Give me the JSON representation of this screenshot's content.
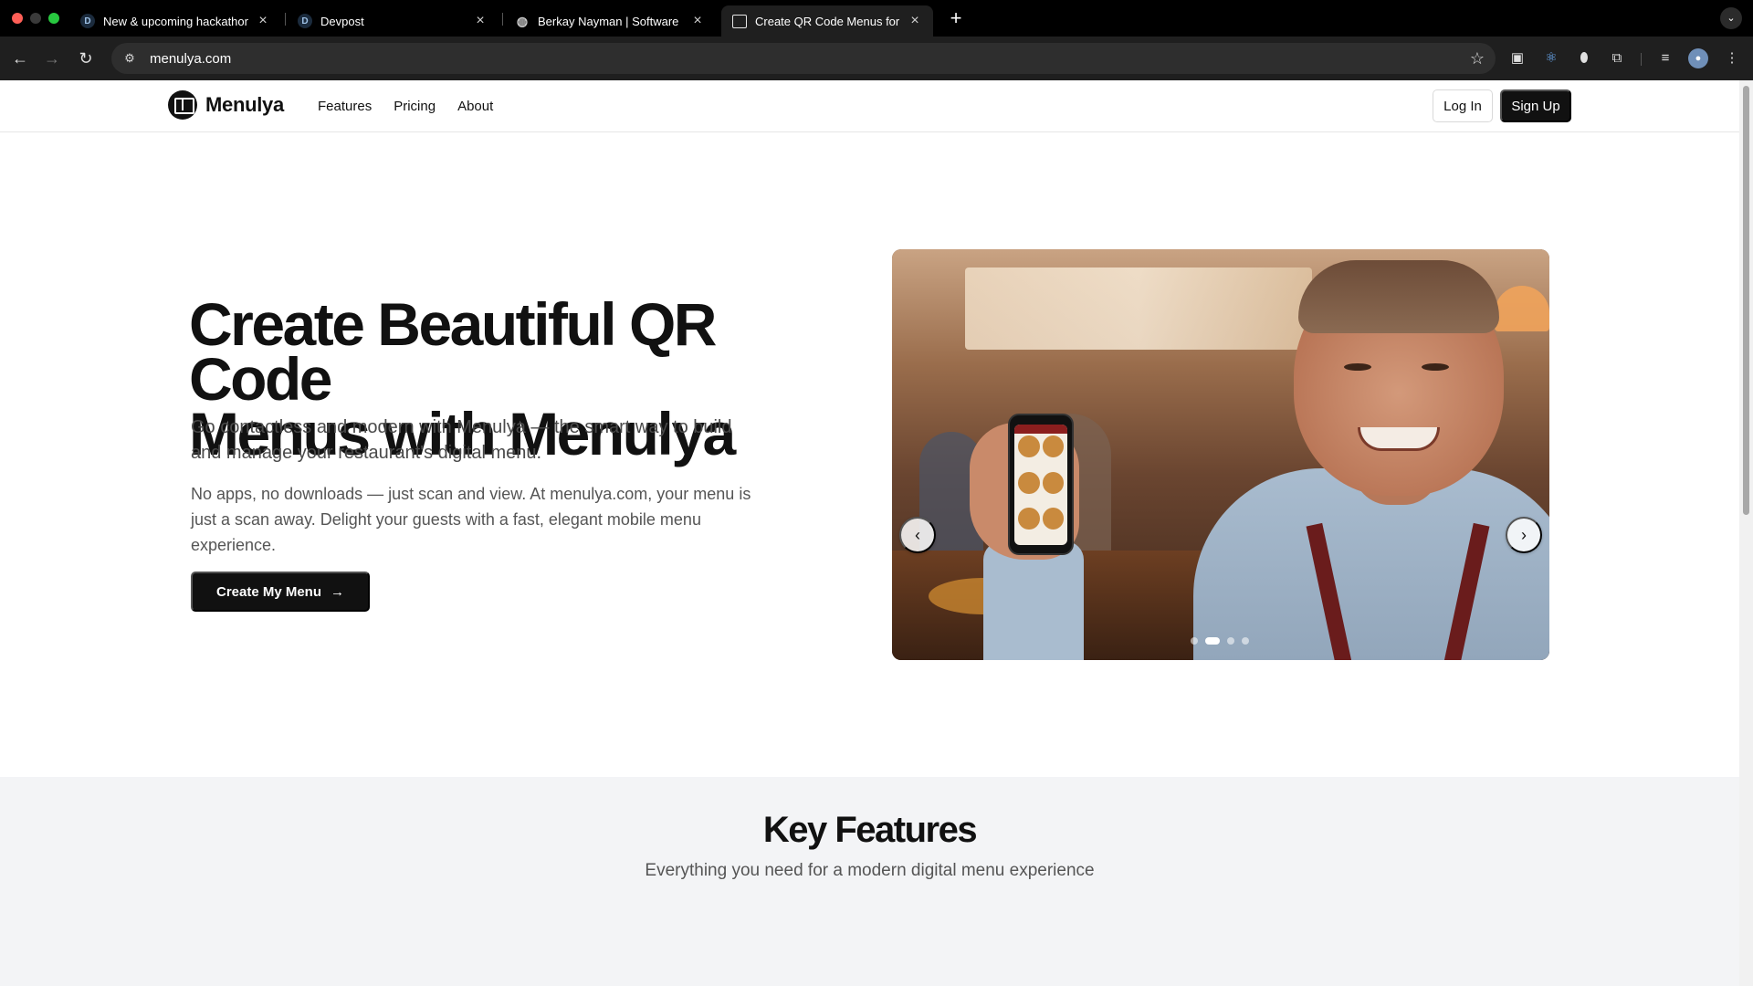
{
  "browser": {
    "tabs": [
      {
        "title": "New & upcoming hackathons",
        "icon": "devpost-icon"
      },
      {
        "title": "Devpost",
        "icon": "devpost-icon"
      },
      {
        "title": "Berkay Nayman | Software De",
        "icon": "globe-icon"
      },
      {
        "title": "Create QR Code Menus for Fr",
        "icon": "qr-icon",
        "active": true
      }
    ],
    "url": "menulya.com"
  },
  "site": {
    "logo_text": "Menulya",
    "nav": [
      "Features",
      "Pricing",
      "About"
    ],
    "login_label": "Log In",
    "signup_label": "Sign Up"
  },
  "hero": {
    "title_line1": "Create Beautiful QR Code",
    "title_line2": "Menus with Menulya",
    "subtitle": "Go contactless and modern with Menulya — the smart way to build and manage your restaurant's digital menu.",
    "body": "No apps, no downloads — just scan and view. At menulya.com, your menu is just a scan away. Delight your guests with a fast, elegant mobile menu experience.",
    "cta_label": "Create My Menu"
  },
  "carousel": {
    "slide_count": 4,
    "active_slide": 2
  },
  "features": {
    "title": "Key Features",
    "subtitle": "Everything you need for a modern digital menu experience"
  },
  "colors": {
    "primary": "#111111",
    "section_bg": "#f3f4f6",
    "chrome_bg": "#1f1f1f"
  }
}
